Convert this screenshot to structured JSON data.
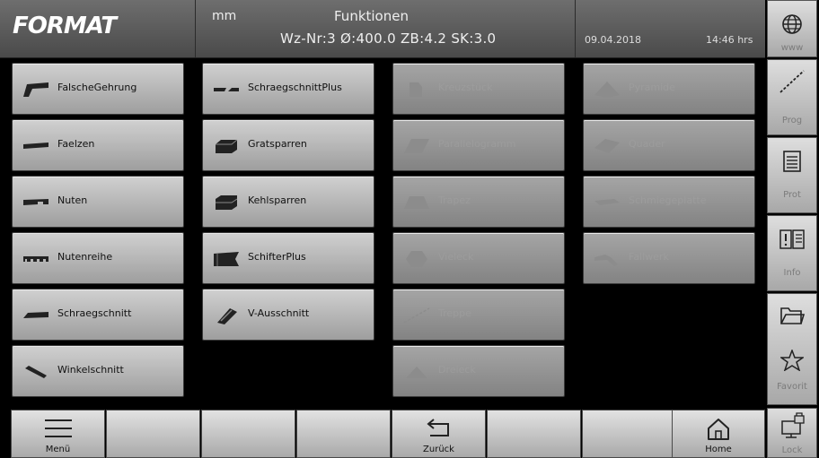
{
  "header": {
    "logo": "FORMAT",
    "unit": "mm",
    "title": "Funktionen",
    "tool_info": "Wz-Nr:3 Ø:400.0 ZB:4.2 SK:3.0",
    "date": "09.04.2018",
    "time": "14:46 hrs"
  },
  "functions": {
    "col1": [
      {
        "label": "FalscheGehrung",
        "icon": "miter-icon"
      },
      {
        "label": "Faelzen",
        "icon": "rebate-icon"
      },
      {
        "label": "Nuten",
        "icon": "groove-icon"
      },
      {
        "label": "Nutenreihe",
        "icon": "groove-row-icon"
      },
      {
        "label": "Schraegschnitt",
        "icon": "bevel-cut-icon"
      },
      {
        "label": "Winkelschnitt",
        "icon": "angle-cut-icon"
      }
    ],
    "col2": [
      {
        "label": "SchraegschnittPlus",
        "icon": "bevel-plus-icon"
      },
      {
        "label": "Gratsparren",
        "icon": "hip-rafter-icon"
      },
      {
        "label": "Kehlsparren",
        "icon": "valley-rafter-icon"
      },
      {
        "label": "SchifterPlus",
        "icon": "jack-rafter-icon"
      },
      {
        "label": "V-Ausschnitt",
        "icon": "v-cut-icon"
      }
    ],
    "col3_disabled": [
      {
        "label": "Kreuzstück",
        "icon": "block-icon"
      },
      {
        "label": "Parallelogramm",
        "icon": "parallelogram-icon"
      },
      {
        "label": "Trapez",
        "icon": "trapezoid-icon"
      },
      {
        "label": "Vieleck",
        "icon": "polygon-icon"
      },
      {
        "label": "Treppe",
        "icon": "stairs-icon"
      },
      {
        "label": "Dreieck",
        "icon": "triangle-icon"
      }
    ],
    "col4_disabled": [
      {
        "label": "Pyramide",
        "icon": "pyramid-icon"
      },
      {
        "label": "Quader",
        "icon": "cuboid-icon"
      },
      {
        "label": "Schmiegeplatte",
        "icon": "plate-icon"
      },
      {
        "label": "Fallwerk",
        "icon": "fold-icon"
      }
    ]
  },
  "sidebar": {
    "www": "www",
    "prog": "Prog",
    "prot": "Prot",
    "info": "Info",
    "favorit": "Favorit",
    "lock": "Lock"
  },
  "footer": {
    "menu": "Menü",
    "back": "Zurück",
    "home": "Home"
  }
}
